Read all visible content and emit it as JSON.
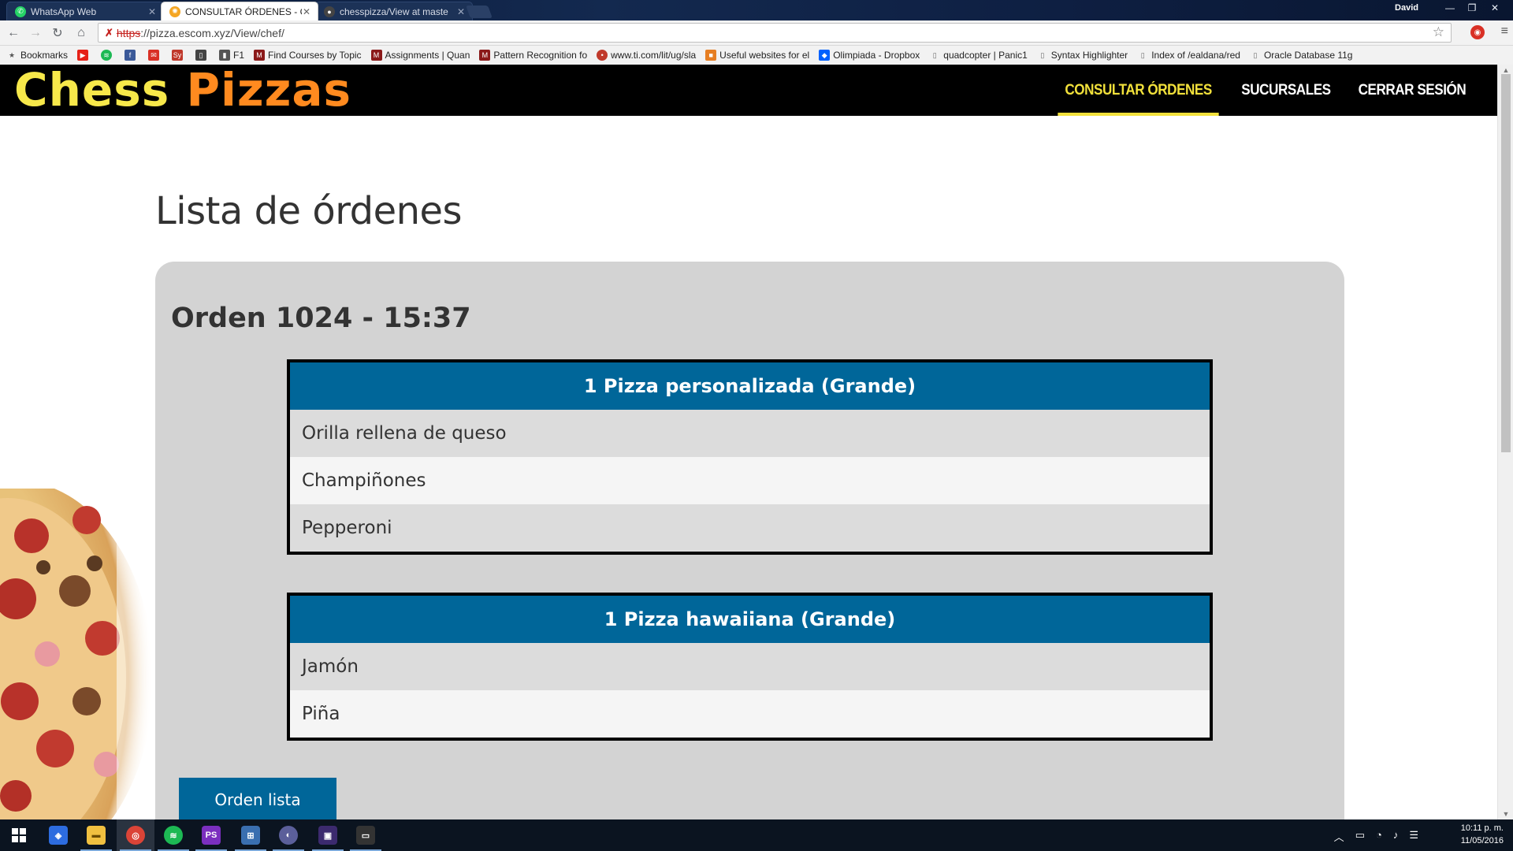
{
  "browser": {
    "tabs": [
      {
        "title": "WhatsApp Web",
        "active": false
      },
      {
        "title": "CONSULTAR ÓRDENES - C",
        "active": true
      },
      {
        "title": "chesspizza/View at maste",
        "active": false
      }
    ],
    "user": "David",
    "url_scheme": "https",
    "url_rest": "://pizza.escom.xyz/View/chef/",
    "bookmarks": [
      "Bookmarks",
      "F1",
      "Find Courses by Topic",
      "Assignments | Quan",
      "Pattern Recognition fo",
      "www.ti.com/lit/ug/sla",
      "Useful websites for el",
      "Olimpiada - Dropbox",
      "quadcopter | Panic1",
      "Syntax Highlighter",
      "Index of /ealdana/red",
      "Oracle Database 11g"
    ]
  },
  "site": {
    "logo_part1": "Chess",
    "logo_part2": "Pizzas",
    "nav": [
      {
        "label": "CONSULTAR ÓRDENES",
        "active": true
      },
      {
        "label": "SUCURSALES",
        "active": false
      },
      {
        "label": "CERRAR SESIÓN",
        "active": false
      }
    ],
    "accent_color": "#f2e13b",
    "header_bg": "#000000"
  },
  "page": {
    "title": "Lista de órdenes",
    "order": {
      "title": "Orden 1024 - 15:37",
      "items": [
        {
          "header": "1 Pizza personalizada (Grande)",
          "ingredients": [
            "Orilla rellena de queso",
            "Champiñones",
            "Pepperoni"
          ]
        },
        {
          "header": "1 Pizza hawaiiana (Grande)",
          "ingredients": [
            "Jamón",
            "Piña"
          ]
        }
      ],
      "ready_button": "Orden lista"
    },
    "table_header_color": "#006699"
  },
  "taskbar": {
    "time": "10:11 p. m.",
    "date": "11/05/2016"
  }
}
